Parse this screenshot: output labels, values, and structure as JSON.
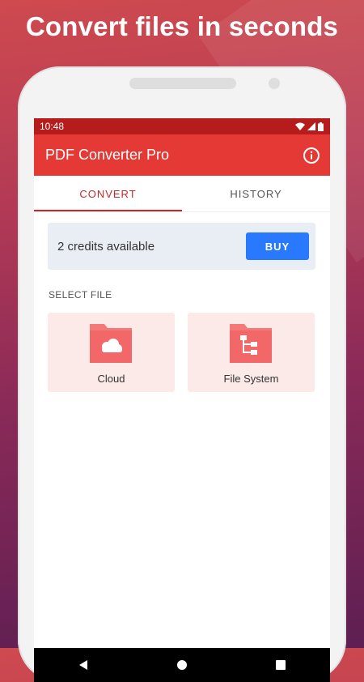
{
  "headline": "Convert files in seconds",
  "status_bar": {
    "time": "10:48"
  },
  "app_bar": {
    "title": "PDF Converter Pro",
    "info_icon": "info-icon"
  },
  "tabs": [
    {
      "label": "CONVERT",
      "active": true
    },
    {
      "label": "HISTORY",
      "active": false
    }
  ],
  "credits": {
    "text": "2 credits available",
    "buy_label": "BUY"
  },
  "select_file": {
    "heading": "SELECT FILE",
    "options": [
      {
        "label": "Cloud",
        "icon": "cloud-folder-icon"
      },
      {
        "label": "File System",
        "icon": "file-tree-folder-icon"
      }
    ]
  },
  "colors": {
    "status_bar": "#b71c1c",
    "app_bar": "#e53935",
    "accent": "#c62828",
    "buy_button": "#2979ff",
    "card_bg": "#fbeae8",
    "folder_icon": "#f47a7a"
  }
}
